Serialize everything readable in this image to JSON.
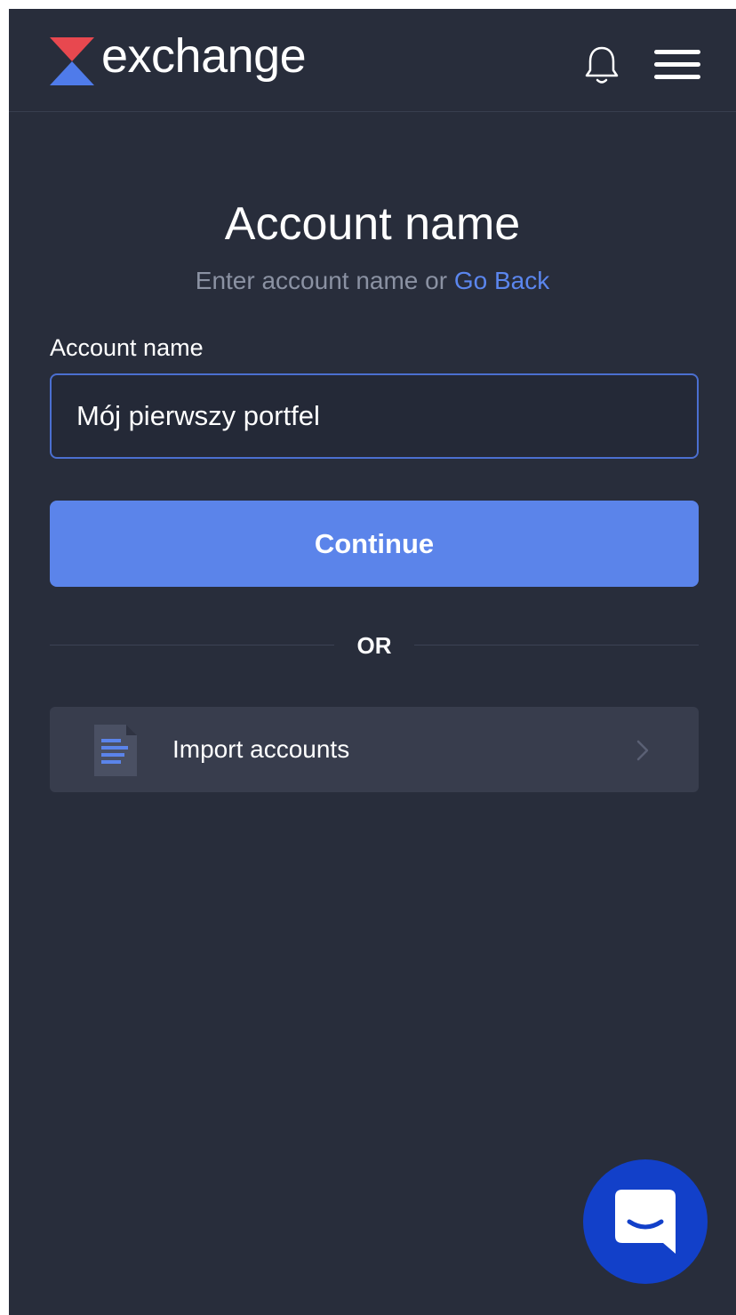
{
  "header": {
    "logo_text": "exchange",
    "icons": [
      "bell-icon",
      "hamburger-menu-icon"
    ]
  },
  "main": {
    "title": "Account name",
    "subtitle_prefix": "Enter account name or ",
    "go_back_link": "Go Back",
    "field_label": "Account name",
    "account_name_value": "Mój pierwszy portfel",
    "continue_label": "Continue",
    "divider_text": "OR",
    "import": {
      "label": "Import accounts",
      "icon": "document-icon",
      "chevron": "chevron-right-icon"
    }
  },
  "chat_button": {
    "icon": "chat-icon"
  },
  "colors": {
    "background": "#282d3b",
    "accent": "#5b84ea",
    "link": "#5b86ee",
    "chat": "#1240c9",
    "logo_red": "#e8484f",
    "logo_blue": "#4f7bea"
  }
}
